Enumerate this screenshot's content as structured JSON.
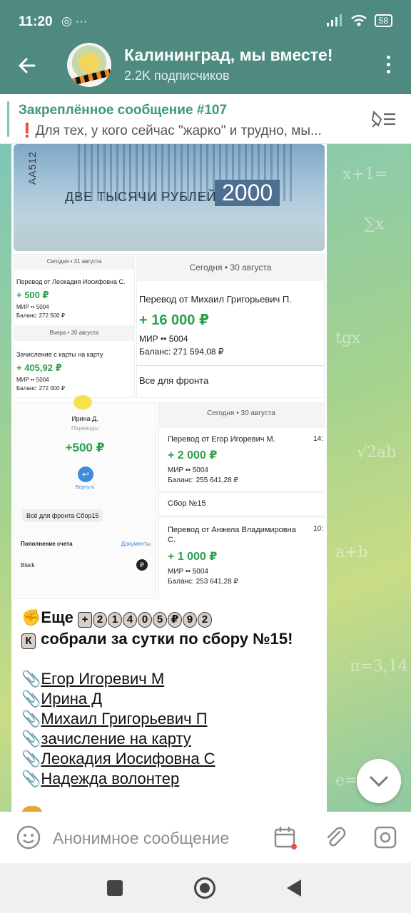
{
  "status": {
    "time": "11:20",
    "left_icons": "◎ ···",
    "battery": "58"
  },
  "header": {
    "title": "Калининград, мы вместе!",
    "subtitle": "2.2K подписчиков"
  },
  "pinned": {
    "title": "Закреплённое сообщение #107",
    "text": "❗Для тех, у кого сейчас \"жарко\" и трудно, мы..."
  },
  "photo": {
    "serial": "AA512",
    "bill_text": "ДВЕ ТЫСЯЧИ РУБЛЕЙ",
    "bill_num": "2000"
  },
  "receipt1": {
    "date1": "Сегодня • 31 августа",
    "name1": "Перевод от Леокадия Иосифовна С.",
    "amount1": "+ 500 ₽",
    "card1": "МИР •• 5004",
    "bal1": "Баланс: 272 500 ₽",
    "date2": "Вчера • 30 августа",
    "name2": "Зачисление с карты на карту",
    "amount2": "+ 405,92 ₽",
    "card2": "МИР •• 5004",
    "bal2": "Баланс: 272 000 ₽"
  },
  "receipt2": {
    "date": "Сегодня • 30 августа",
    "name": "Перевод от Михаил Григорьевич П.",
    "amount": "+ 16 000 ₽",
    "card": "МИР •• 5004",
    "bal": "Баланс: 271 594,08 ₽",
    "note": "Все для фронта"
  },
  "receipt3": {
    "name": "Ирина Д.",
    "sub": "Переводы",
    "amount": "+500 ₽",
    "back": "Вернуть",
    "note": "Всё для фронта Сбор15",
    "acc": "Пополнение счета",
    "docs": "Документы",
    "black": "Black"
  },
  "receipt4": {
    "date": "Сегодня • 30 августа",
    "name1": "Перевод от Егор Игоревич М.",
    "time1": "14:",
    "amount1": "+ 2 000 ₽",
    "card1": "МИР •• 5004",
    "bal1": "Баланс: 255 641,28 ₽",
    "note": "Сбор №15",
    "name2": "Перевод от Анжела Владимировна С.",
    "time2": "10:",
    "amount2": "+ 1 000 ₽",
    "card2": "МИР •• 5004",
    "bal2": "Баланс: 253 641,28 ₽"
  },
  "message": {
    "line1_pre": "Еще",
    "keys": [
      "+",
      "2",
      "1",
      "4",
      "0",
      "5",
      "₽",
      "9",
      "2"
    ],
    "line2_key": "К",
    "line2": "собрали за сутки по сбору №15!",
    "links": [
      "Егор Игоревич М",
      "Ирина Д",
      "Михаил Григорьевич П",
      "зачисление на карту",
      "Леокадия Иосифовна С",
      "Надежда волонтер"
    ]
  },
  "compose": {
    "placeholder": "Анонимное сообщение"
  },
  "colors": {
    "header": "#4e8a7f",
    "accent_green": "#2aa14a",
    "pinned_title": "#3a9a7a"
  }
}
